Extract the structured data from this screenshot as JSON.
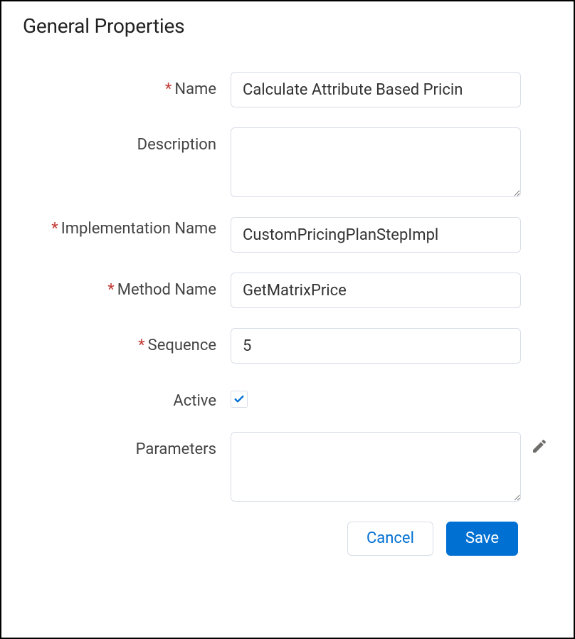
{
  "panel": {
    "title": "General Properties"
  },
  "fields": {
    "name": {
      "label": "Name",
      "required": true,
      "value": "Calculate Attribute Based Pricin"
    },
    "description": {
      "label": "Description",
      "required": false,
      "value": ""
    },
    "implementationName": {
      "label": "Implementation Name",
      "required": true,
      "value": "CustomPricingPlanStepImpl"
    },
    "methodName": {
      "label": "Method Name",
      "required": true,
      "value": "GetMatrixPrice"
    },
    "sequence": {
      "label": "Sequence",
      "required": true,
      "value": "5"
    },
    "active": {
      "label": "Active",
      "required": false,
      "checked": true
    },
    "parameters": {
      "label": "Parameters",
      "required": false,
      "value": ""
    }
  },
  "buttons": {
    "cancel": "Cancel",
    "save": "Save"
  },
  "requiredMarker": "*"
}
